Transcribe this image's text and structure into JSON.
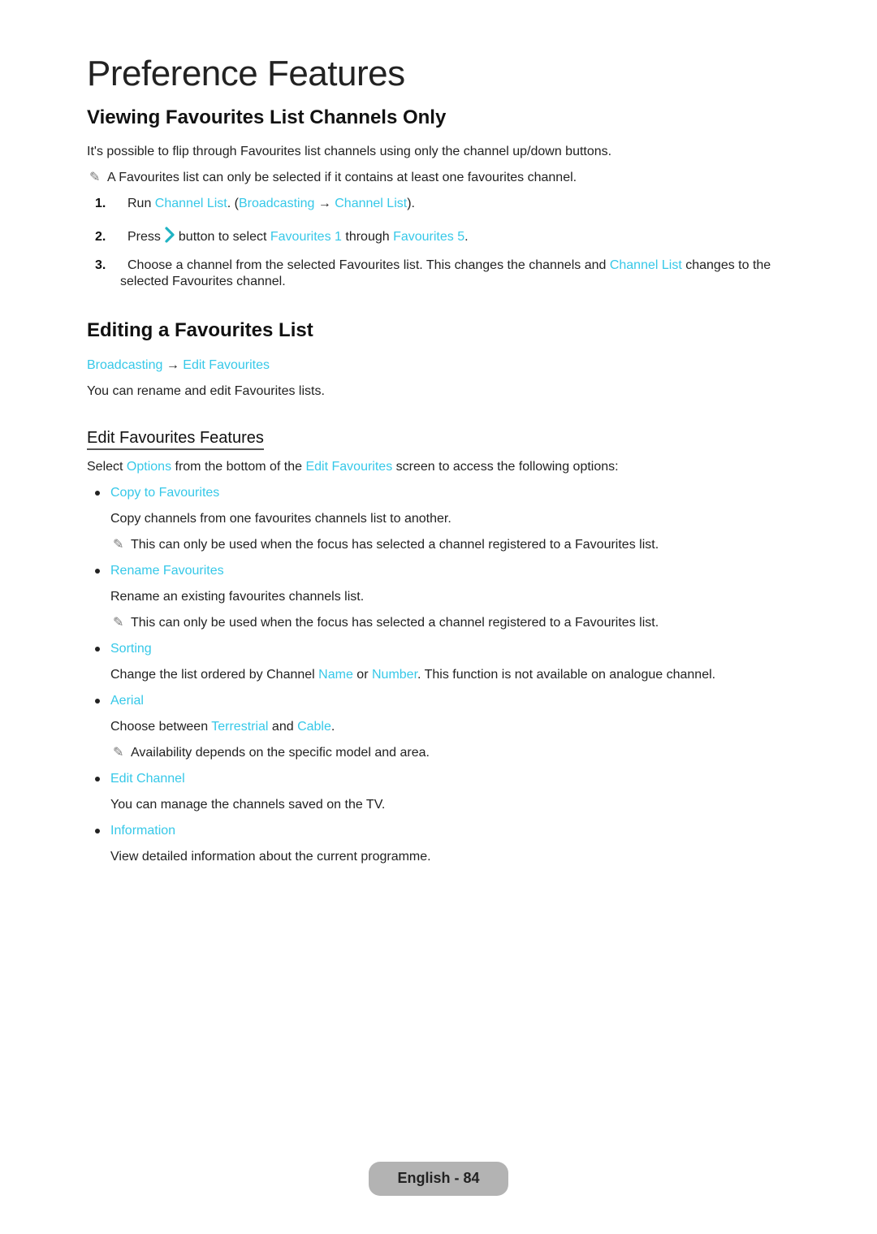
{
  "page_title": "Preference Features",
  "section1": {
    "heading": "Viewing Favourites List Channels Only",
    "intro": "It's possible to flip through Favourites list channels using only the channel up/down buttons.",
    "note": "A Favourites list can only be selected if it contains at least one favourites channel.",
    "steps": [
      {
        "num": "1.",
        "t1": "Run ",
        "l1": "Channel List",
        "t2": ". (",
        "l2": "Broadcasting",
        "arrow": " → ",
        "l3": "Channel List",
        "t3": ")."
      },
      {
        "num": "2.",
        "t1": "Press",
        "icon": "chevron-right-icon",
        "t2": "button to select ",
        "l1": "Favourites 1",
        "t3": " through ",
        "l2": "Favourites 5",
        "t4": "."
      },
      {
        "num": "3.",
        "t1": "Choose a channel from the selected Favourites list. This changes the channels and ",
        "l1": "Channel List",
        "t2": " changes to the",
        "line2": "selected Favourites channel."
      }
    ]
  },
  "section2": {
    "heading": "Editing a Favourites List",
    "path_l1": "Broadcasting",
    "path_arrow": " → ",
    "path_l2": "Edit Favourites",
    "desc": "You can rename and edit Favourites lists."
  },
  "section3": {
    "heading": "Edit Favourites Features",
    "intro_t1": "Select ",
    "intro_l1": "Options",
    "intro_t2": " from the bottom of the ",
    "intro_l2": "Edit Favourites",
    "intro_t3": " screen to access the following options:",
    "items": [
      {
        "label": "Copy to Favourites",
        "desc": "Copy channels from one favourites channels list to another.",
        "note": "This can only be used when the focus has selected a channel registered to a Favourites list."
      },
      {
        "label": "Rename Favourites",
        "desc": "Rename an existing favourites channels list.",
        "note": "This can only be used when the focus has selected a channel registered to a Favourites list."
      },
      {
        "label": "Sorting",
        "desc_t1": "Change the list ordered by Channel ",
        "desc_l1": "Name",
        "desc_t2": " or ",
        "desc_l2": "Number",
        "desc_t3": ". This function is not available on analogue channel."
      },
      {
        "label": "Aerial",
        "desc_t1": "Choose between ",
        "desc_l1": "Terrestrial",
        "desc_t2": " and ",
        "desc_l2": "Cable",
        "desc_t3": ".",
        "note": "Availability depends on the specific model and area."
      },
      {
        "label": "Edit Channel",
        "desc": "You can manage the channels saved on the TV."
      },
      {
        "label": "Information",
        "desc": "View detailed information about the current programme."
      }
    ]
  },
  "footer": {
    "label": "English - 84"
  },
  "icons": {
    "note": "✎"
  },
  "colors": {
    "link": "#36c8e8",
    "footer_bg": "#b3b3b3"
  }
}
